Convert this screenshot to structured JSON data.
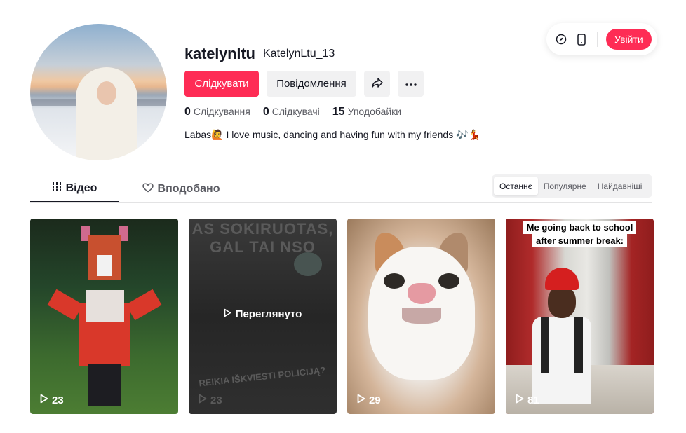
{
  "top_bar": {
    "compass_icon": "compass-icon",
    "mobile_icon": "mobile-phone-icon",
    "login_label": "Увійти"
  },
  "profile": {
    "username": "katelynltu",
    "nickname": "KatelynLtu_13",
    "follow_label": "Слідкувати",
    "message_label": "Повідомлення",
    "share_icon": "share-icon",
    "more_icon": "more-icon",
    "stats": [
      {
        "value": "0",
        "label": "Слідкування"
      },
      {
        "value": "0",
        "label": "Слідкувачі"
      },
      {
        "value": "15",
        "label": "Уподобайки"
      }
    ],
    "bio": "Labas🙋 I love music, dancing and having fun with my friends 🎶💃"
  },
  "tabs": {
    "videos": "Відео",
    "liked": "Вподобано"
  },
  "sort": {
    "latest": "Останнє",
    "popular": "Популярне",
    "oldest": "Найдавніші",
    "active": "latest"
  },
  "videos": [
    {
      "views": "23"
    },
    {
      "views": "23",
      "watched_label": "Переглянуто",
      "top_text_1": "AS SOKIRUOTAS,",
      "top_text_2": "GAL TAI NSO",
      "bottom_text": "REIKIA IŠKVIESTI POLICIJĄ?"
    },
    {
      "views": "29"
    },
    {
      "views": "81",
      "caption_line1": "Me going back to school",
      "caption_line2": "after summer break:"
    }
  ],
  "colors": {
    "accent": "#fe2c55",
    "text_primary": "#161823",
    "text_secondary": "#5b5c63",
    "button_gray": "#f1f1f2"
  }
}
